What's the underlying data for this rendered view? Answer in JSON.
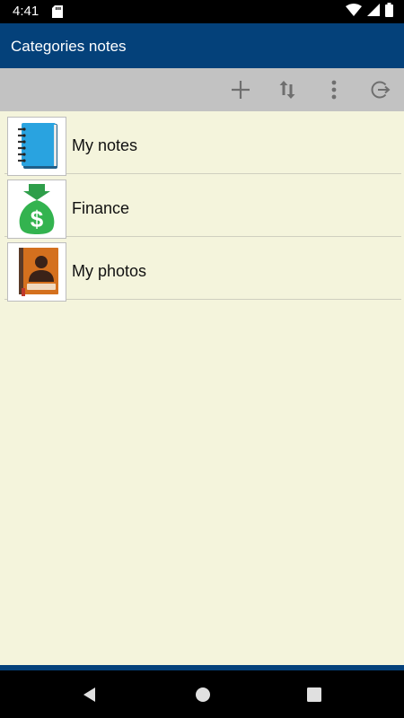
{
  "status": {
    "time": "4:41",
    "icons": [
      "sd-card-icon",
      "wifi-icon",
      "cell-signal-icon",
      "battery-icon"
    ]
  },
  "app": {
    "title": "Categories notes",
    "colors": {
      "primary": "#04417a",
      "toolbar": "#c2c2c2",
      "background": "#f4f4dc"
    }
  },
  "toolbar": {
    "actions": [
      "add-icon",
      "sort-icon",
      "overflow-menu-icon",
      "logout-icon"
    ]
  },
  "categories": [
    {
      "label": "My notes",
      "icon": "notebook-icon"
    },
    {
      "label": "Finance",
      "icon": "money-bag-icon"
    },
    {
      "label": "My photos",
      "icon": "photo-album-icon"
    }
  ],
  "navigation": {
    "buttons": [
      "back-icon",
      "home-icon",
      "recents-icon"
    ]
  }
}
